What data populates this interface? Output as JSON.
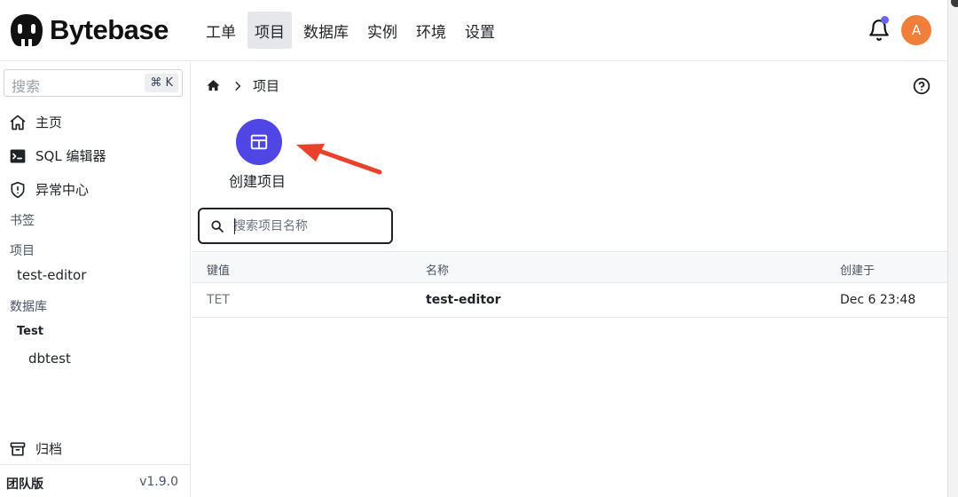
{
  "app": {
    "name": "Bytebase"
  },
  "nav": {
    "items": [
      "工单",
      "项目",
      "数据库",
      "实例",
      "环境",
      "设置"
    ],
    "active_index": 1
  },
  "user": {
    "avatar_initial": "A"
  },
  "sidebar": {
    "search_placeholder": "搜索",
    "search_shortcut": "⌘ K",
    "items": [
      {
        "label": "主页",
        "icon": "home-icon"
      },
      {
        "label": "SQL 编辑器",
        "icon": "terminal-icon"
      },
      {
        "label": "异常中心",
        "icon": "shield-alert-icon"
      }
    ],
    "bookmarks_label": "书签",
    "projects_label": "项目",
    "projects": [
      "test-editor"
    ],
    "databases_label": "数据库",
    "environment": "Test",
    "databases": [
      "dbtest"
    ],
    "archive_label": "归档",
    "plan": "团队版",
    "version": "v1.9.0"
  },
  "main": {
    "breadcrumb": "项目",
    "create_label": "创建项目",
    "search_placeholder": "搜索项目名称",
    "table": {
      "columns": [
        "键值",
        "名称",
        "创建于"
      ],
      "rows": [
        {
          "key": "TET",
          "name": "test-editor",
          "created": "Dec 6 23:48"
        }
      ]
    }
  },
  "colors": {
    "accent": "#4f46e5",
    "avatar": "#f07f3c",
    "arrow": "#e8412c",
    "notification": "#6b63ff"
  }
}
